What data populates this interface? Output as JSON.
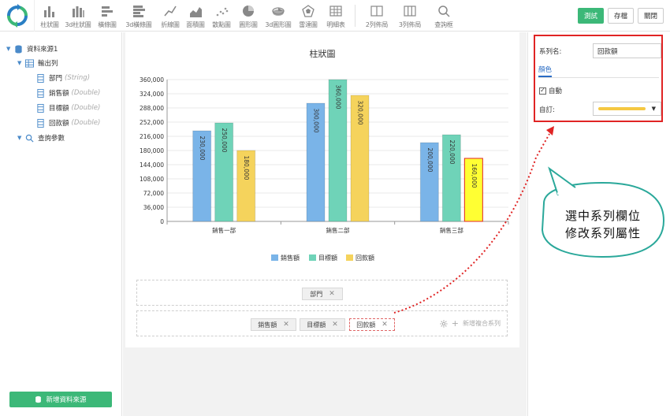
{
  "toolbar": {
    "tools": [
      {
        "name": "bar-chart-tool",
        "icon": "bar-chart-icon",
        "label": "柱狀圖"
      },
      {
        "name": "3d-bar-chart-tool",
        "icon": "3d-bar-chart-icon",
        "label": "3d柱狀圖"
      },
      {
        "name": "horizontal-bar-tool",
        "icon": "horizontal-bar-icon",
        "label": "橫條圖"
      },
      {
        "name": "3d-horizontal-bar-tool",
        "icon": "3d-horizontal-bar-icon",
        "label": "3d橫條圖"
      },
      {
        "name": "line-chart-tool",
        "icon": "line-chart-icon",
        "label": "折線圖"
      },
      {
        "name": "area-chart-tool",
        "icon": "area-chart-icon",
        "label": "面積圖"
      },
      {
        "name": "scatter-chart-tool",
        "icon": "scatter-chart-icon",
        "label": "散點圖"
      },
      {
        "name": "pie-chart-tool",
        "icon": "pie-chart-icon",
        "label": "圓形圖"
      },
      {
        "name": "3d-pie-chart-tool",
        "icon": "3d-pie-chart-icon",
        "label": "3d圓形圖"
      },
      {
        "name": "radar-chart-tool",
        "icon": "radar-chart-icon",
        "label": "雷達圖"
      },
      {
        "name": "detail-table-tool",
        "icon": "table-icon",
        "label": "明細表"
      }
    ],
    "layout_tools": [
      {
        "name": "two-column-layout-tool",
        "icon": "two-column-icon",
        "label": "2列佈局"
      },
      {
        "name": "three-column-layout-tool",
        "icon": "three-column-icon",
        "label": "3列佈局"
      },
      {
        "name": "query-box-tool",
        "icon": "search-icon",
        "label": "查詢框"
      }
    ],
    "test_label": "測試",
    "save_label": "存檔",
    "close_label": "關閉"
  },
  "left": {
    "datasource": "資料來源1",
    "output_columns": "輸出列",
    "fields": [
      {
        "name": "部門",
        "type": "(String)"
      },
      {
        "name": "銷售額",
        "type": "(Double)"
      },
      {
        "name": "目標額",
        "type": "(Double)"
      },
      {
        "name": "回款額",
        "type": "(Double)"
      }
    ],
    "query_params": "查詢參數",
    "add_datasource": "新增資料來源"
  },
  "chart_data": {
    "type": "bar",
    "title": "柱狀圖",
    "categories": [
      "銷售一部",
      "銷售二部",
      "銷售三部"
    ],
    "series": [
      {
        "name": "銷售額",
        "values": [
          230000,
          300000,
          200000
        ],
        "color": "#7ab4e8"
      },
      {
        "name": "目標額",
        "values": [
          250000,
          360000,
          220000
        ],
        "color": "#6fd3b8"
      },
      {
        "name": "回款額",
        "values": [
          180000,
          320000,
          160000
        ],
        "color": "#f5d35c"
      }
    ],
    "data_labels": [
      [
        "230,000",
        "250,000",
        "180,000"
      ],
      [
        "300,000",
        "360,000",
        "320,000"
      ],
      [
        "200,000",
        "220,000",
        "160,000"
      ]
    ],
    "highlight": {
      "category_index": 2,
      "series_index": 2,
      "color": "#ffff33"
    },
    "yticks": [
      "0",
      "36,000",
      "72,000",
      "108,000",
      "144,000",
      "180,000",
      "216,000",
      "252,000",
      "288,000",
      "324,000",
      "360,000"
    ],
    "ylim": [
      0,
      360000
    ],
    "grid": true,
    "legend_position": "bottom"
  },
  "drop": {
    "category_chip": "部門",
    "series_chips": [
      "銷售額",
      "目標額",
      "回款額"
    ],
    "add_combo": "新增複合系列"
  },
  "props": {
    "series_name_label": "系列名:",
    "series_name_value": "回款額",
    "color_tab": "顏色",
    "auto_label": "自動",
    "custom_label": "自訂:",
    "custom_color": "#f5c842"
  },
  "annotation": {
    "line1": "選中系列欄位",
    "line2": "修改系列屬性"
  }
}
